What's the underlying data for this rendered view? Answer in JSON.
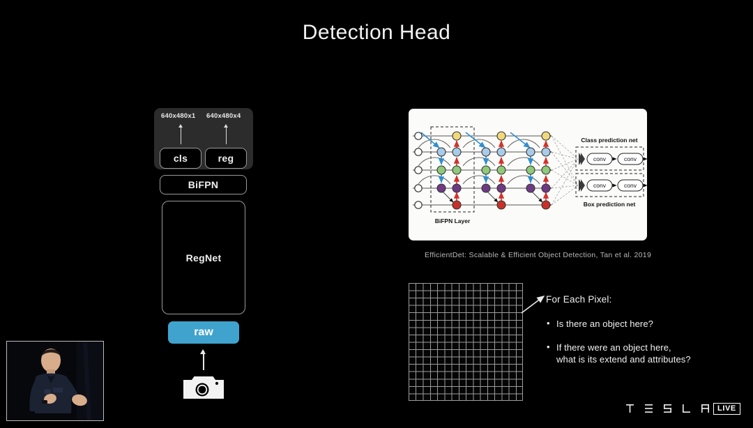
{
  "slide": {
    "title": "Detection Head",
    "background_color": "#000000"
  },
  "architecture": {
    "panel_label": "detection-head-panel",
    "output_dims": [
      {
        "label": "640x480x1",
        "for": "cls"
      },
      {
        "label": "640x480x4",
        "for": "reg"
      }
    ],
    "heads": [
      {
        "label": "cls"
      },
      {
        "label": "reg"
      }
    ],
    "neck": {
      "label": "BiFPN"
    },
    "backbone": {
      "label": "RegNet"
    },
    "input": {
      "label": "raw",
      "color": "#40a3cd"
    },
    "source_icon": "camera-icon"
  },
  "figure": {
    "caption": "EfficientDet: Scalable & Efficient Object Detection, Tan et al. 2019",
    "bifpn_layer_label": "BiFPN Layer",
    "class_net_label": "Class prediction net",
    "box_net_label": "Box prediction net",
    "conv_label": "conv",
    "node_colors": {
      "input": "#ffffff",
      "level_p7": "#efd97a",
      "level_p6": "#a8cce8",
      "level_p5": "#8fc97a",
      "level_p4": "#7b3f8f",
      "level_p3": "#c8302a",
      "topdown_arrow": "#2f8fd0",
      "bottomup_arrow": "#d2322a"
    }
  },
  "pixel_question": {
    "heading": "For Each Pixel:",
    "bullets": [
      "Is there an object here?",
      "If there were an object here,\nwhat is its extend and attributes?"
    ]
  },
  "grid": {
    "name": "pixel-grid",
    "columns": 16,
    "rows": 16
  },
  "footer": {
    "wordmark": "TESLA",
    "live_badge": "LIVE"
  },
  "presenter_pip": {
    "name": "presenter-video"
  }
}
